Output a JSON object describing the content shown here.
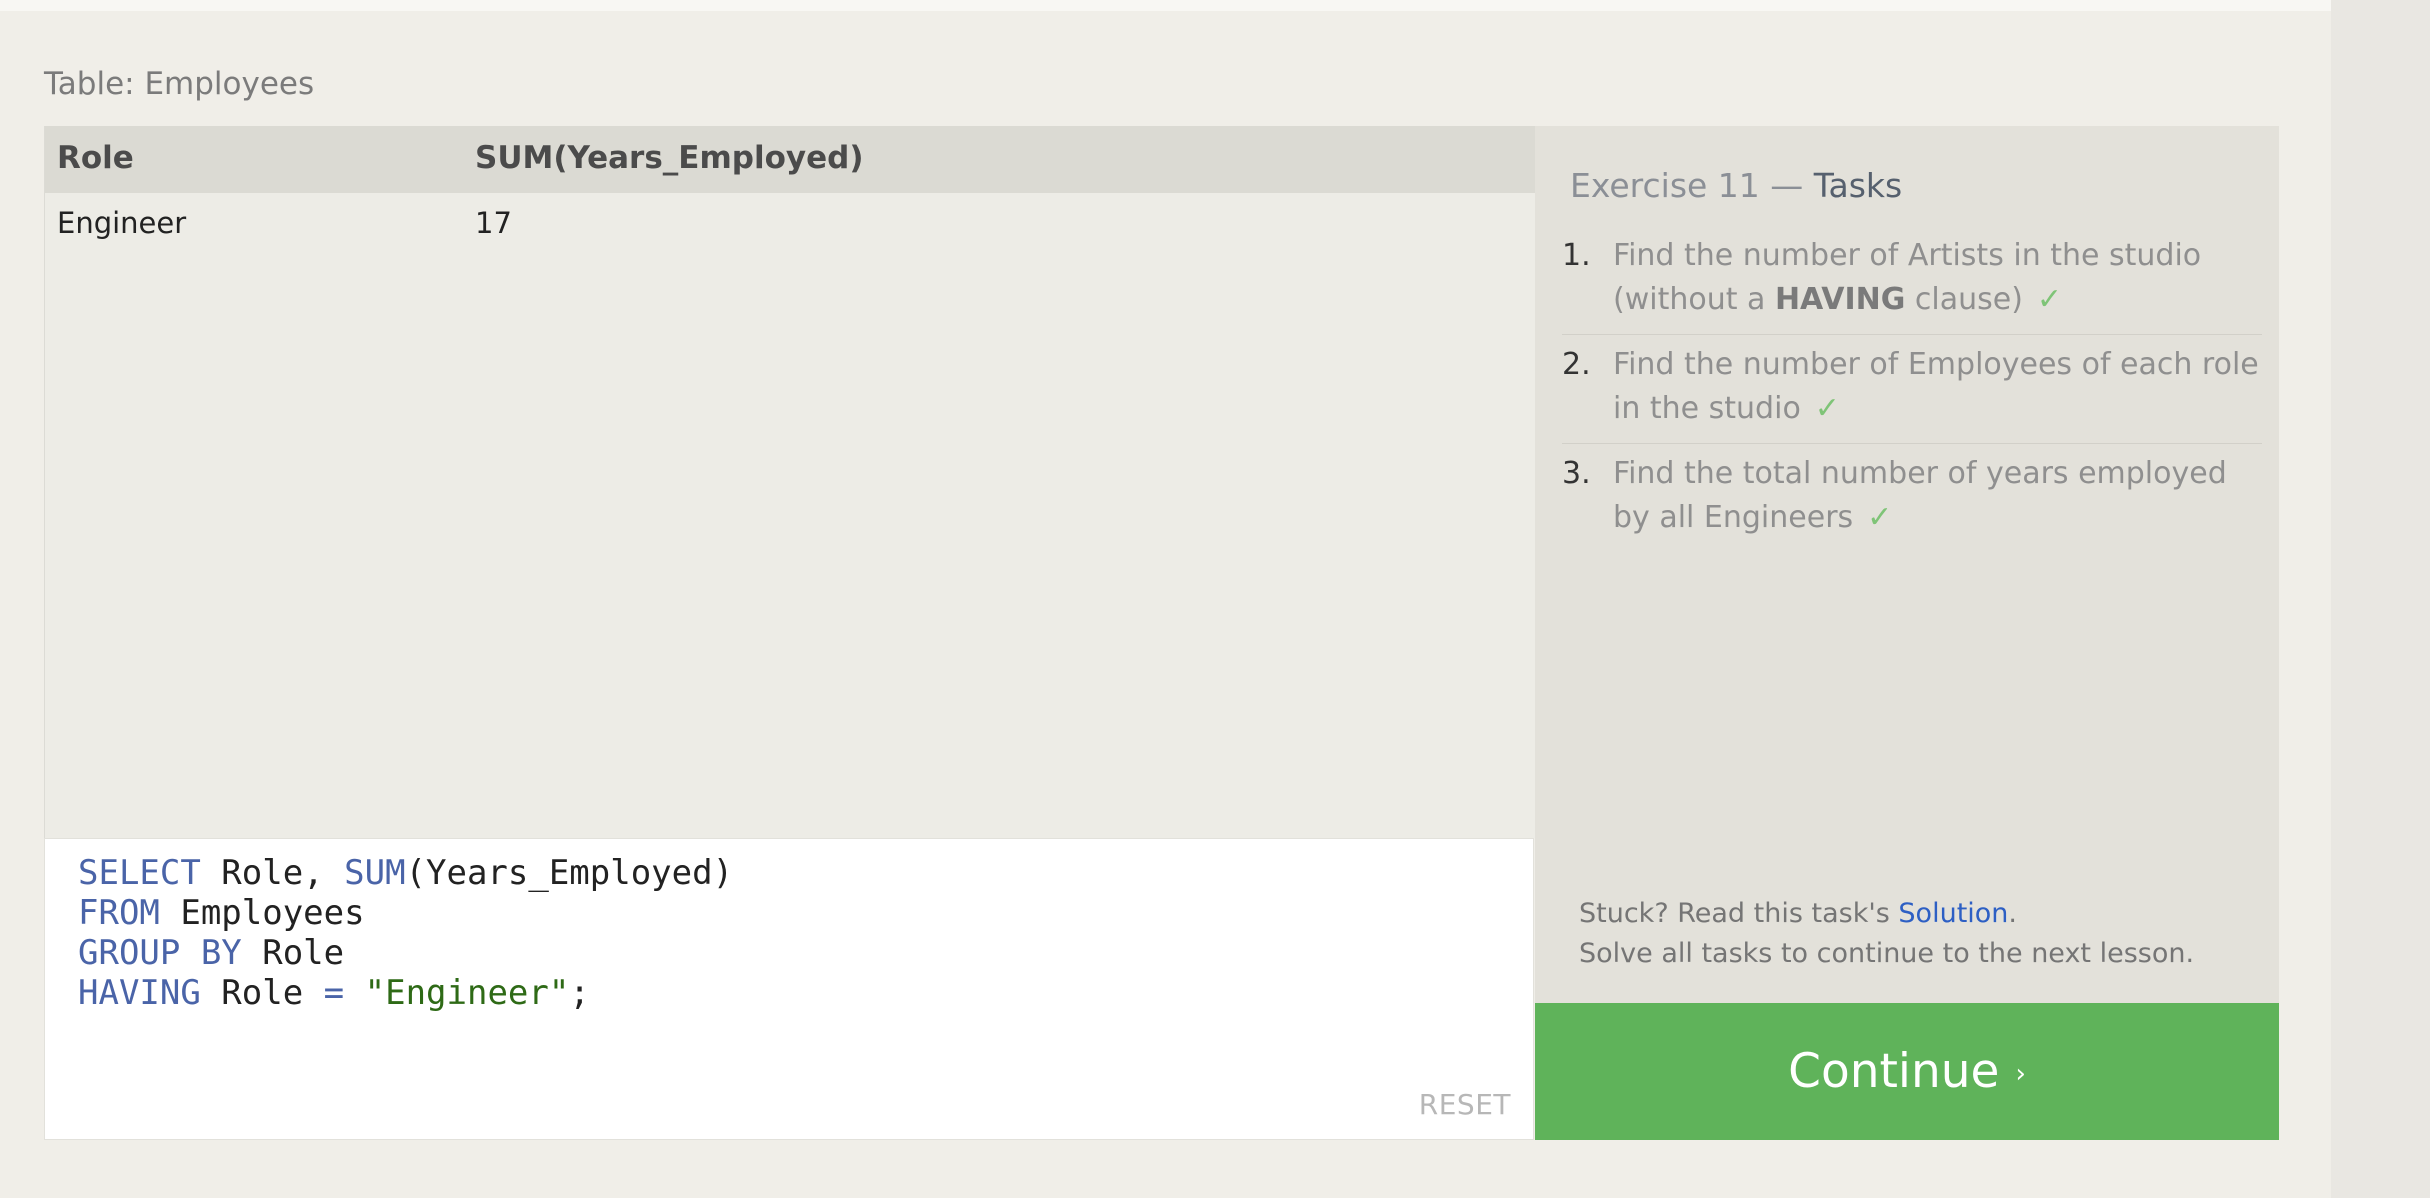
{
  "table_caption": "Table: Employees",
  "results": {
    "columns": [
      "Role",
      "SUM(Years_Employed)"
    ],
    "rows": [
      [
        "Engineer",
        "17"
      ]
    ]
  },
  "editor": {
    "line1": {
      "kw1": "SELECT",
      "t1": " Role, ",
      "kw2": "SUM",
      "t2": "(Years_Employed)"
    },
    "line2": {
      "kw": "FROM",
      "t": " Employees"
    },
    "line3": {
      "kw": "GROUP BY",
      "t": " Role"
    },
    "line4": {
      "kw": "HAVING",
      "t1": " Role ",
      "op": "=",
      "t2": " ",
      "str": "\"Engineer\"",
      "t3": ";"
    },
    "reset_label": "RESET"
  },
  "tasks_panel": {
    "title_prefix": "Exercise 11 — ",
    "title_strong": "Tasks",
    "tasks": [
      {
        "num": "1.",
        "text_a": "Find the number of Artists in the studio (without a ",
        "bold": "HAVING",
        "text_b": " clause)",
        "check": "✓"
      },
      {
        "num": "2.",
        "text_a": "Find the number of Employees of each role in the studio",
        "check": "✓"
      },
      {
        "num": "3.",
        "text_a": "Find the total number of years employed by all Engineers",
        "check": "✓"
      }
    ],
    "help_prefix": "Stuck? Read this task's ",
    "help_link": "Solution",
    "help_suffix": ".",
    "help_line2": "Solve all tasks to continue to the next lesson."
  },
  "continue_button": {
    "label": "Continue",
    "chevron": "›"
  },
  "colors": {
    "keyword": "#4a64a8",
    "string": "#2e6a16",
    "continue_bg": "#5fb35a",
    "check": "#7fc477",
    "link": "#2d5fc4"
  }
}
